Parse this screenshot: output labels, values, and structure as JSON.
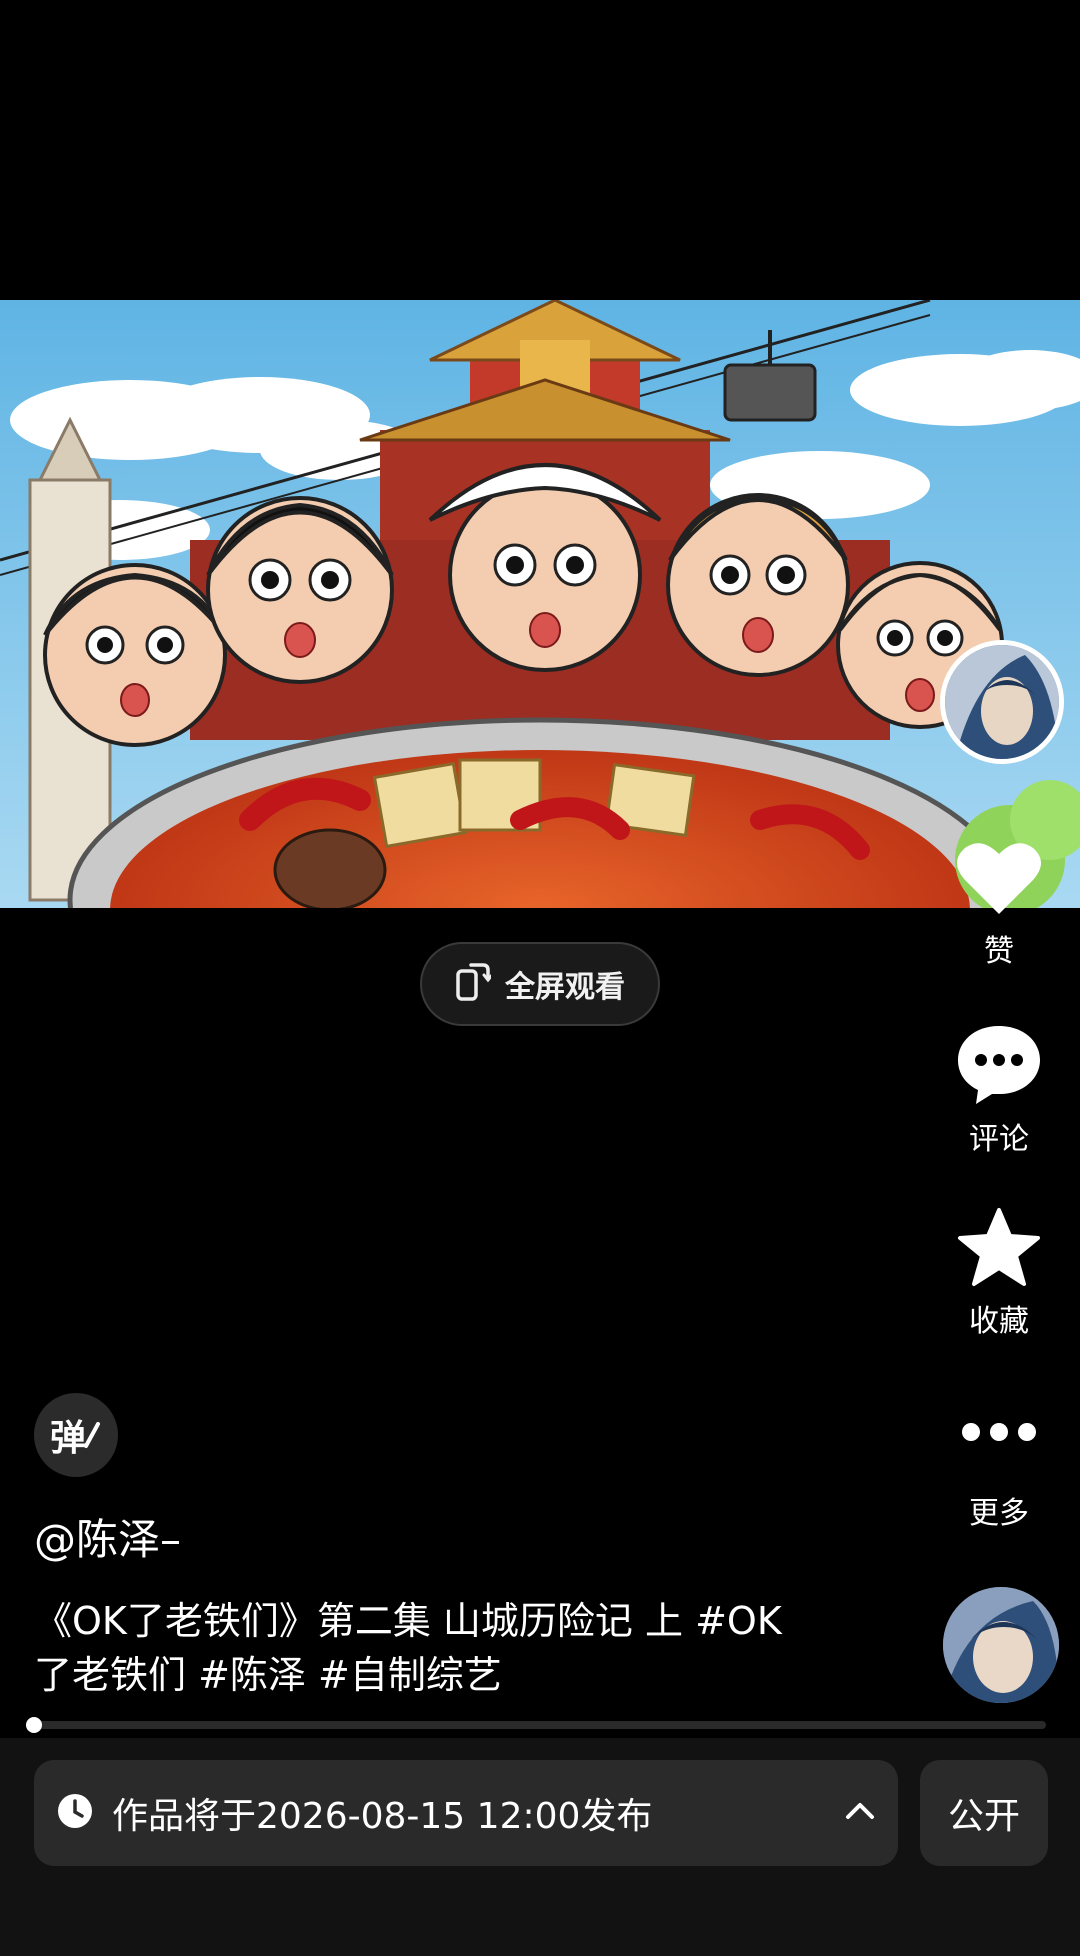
{
  "video": {
    "fullscreen_label": "全屏观看"
  },
  "actions": {
    "like_label": "赞",
    "comment_label": "评论",
    "favorite_label": "收藏",
    "more_label": "更多"
  },
  "danmu": {
    "label": "弹"
  },
  "post": {
    "author": "@陈泽–",
    "description": "《OK了老铁们》第二集 山城历险记 上 #OK了老铁们 #陈泽 #自制综艺"
  },
  "progress": {
    "fraction": 0
  },
  "bottom": {
    "schedule_text": "作品将于2026-08-15 12:00发布",
    "visibility_label": "公开"
  },
  "icons": {
    "fullscreen": "fullscreen-rotate-icon",
    "like": "heart-icon",
    "comment": "comment-bubble-icon",
    "favorite": "star-icon",
    "more": "more-dots-icon",
    "clock": "clock-icon",
    "chevron": "chevron-up-icon"
  }
}
